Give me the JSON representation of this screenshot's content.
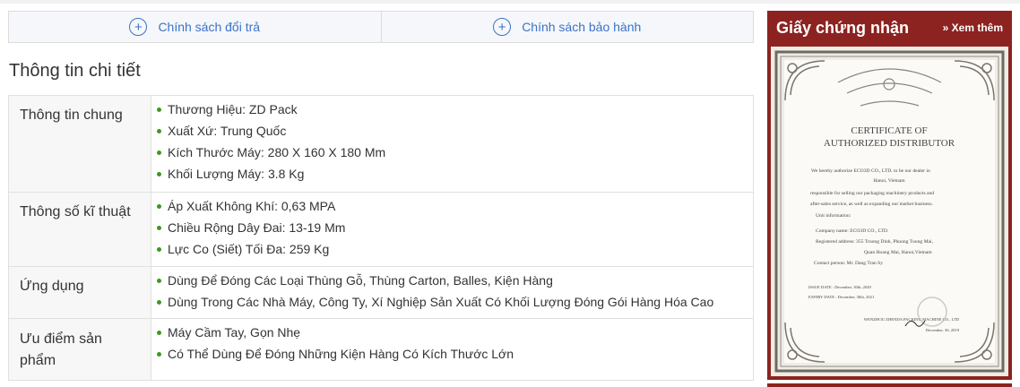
{
  "policy_tabs": [
    {
      "icon": "plus-circle-icon",
      "label": "Chính sách đổi trả"
    },
    {
      "icon": "plus-circle-icon",
      "label": "Chính sách bảo hành"
    }
  ],
  "details": {
    "title": "Thông tin chi tiết",
    "rows": [
      {
        "label": "Thông tin chung",
        "items": [
          "Thương Hiệu: ZD Pack",
          "Xuất Xứ: Trung Quốc",
          "Kích Thước Máy: 280 X 160 X 180 Mm",
          "Khối Lượng Máy: 3.8 Kg"
        ]
      },
      {
        "label": "Thông số kĩ thuật",
        "items": [
          "Áp Xuất Không Khí: 0,63 MPA",
          "Chiều Rộng Dây Đai: 13-19 Mm",
          "Lực Co (Siết) Tối Đa: 259 Kg"
        ]
      },
      {
        "label": "Ứng dụng",
        "items": [
          "Dùng Để Đóng Các Loại Thùng Gỗ, Thùng Carton, Balles, Kiện Hàng",
          "Dùng Trong Các Nhà Máy, Công Ty, Xí Nghiệp Sản Xuất Có Khối Lượng Đóng Gói Hàng Hóa Cao"
        ]
      },
      {
        "label": "Ưu điểm sản phẩm",
        "items": [
          "Máy Cầm Tay, Gọn Nhẹ",
          "Có Thể Dùng Để Đóng Những Kiện Hàng Có Kích Thước Lớn"
        ]
      }
    ]
  },
  "certificate": {
    "title": "Giấy chứng nhận",
    "more_label": "» Xem thêm",
    "doc": {
      "heading1": "CERTIFICATE OF",
      "heading2": "AUTHORIZED DISTRIBUTOR",
      "lines": [
        "We hereby authorize ECO3D CO., LTD. to be our dealer in",
        "Hanoi, Vietnam",
        "responsible for selling our packaging machinery products and",
        "after-sales service, as well as expanding our market business.",
        "Unit information:",
        "Company name:  ECO3D CO., LTD.",
        "Registered address: 355 Truong Dinh, Phuong Tuong Mai,",
        "Quan Hoang Mai, Hanoi,Vietnam",
        "Contact person:   Mr. Dang Tran Sy",
        "ISSUE  DATE : December, 30th, 2020",
        "EXPIRY DATE : December, 30th, 2021",
        "WENZHOU ZHENDA PACKING MACHINE CO., LTD",
        "December, 30, 2019"
      ]
    }
  }
}
